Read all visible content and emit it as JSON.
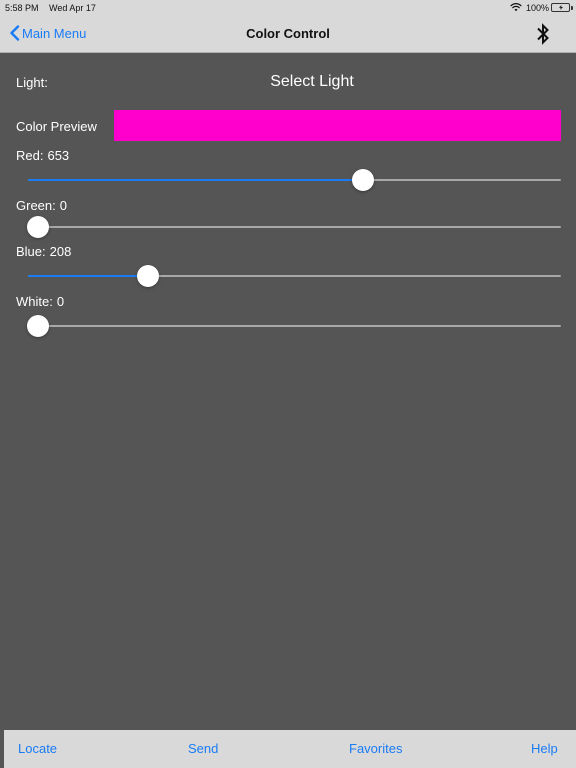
{
  "status_bar": {
    "time": "5:58 PM",
    "date": "Wed Apr 17",
    "battery": "100%",
    "icons": [
      "wifi-icon",
      "battery-icon"
    ]
  },
  "nav": {
    "back_label": "Main Menu",
    "title": "Color Control",
    "icons": [
      "chevron-left-icon",
      "bluetooth-icon"
    ]
  },
  "light": {
    "label": "Light:",
    "select_label": "Select Light"
  },
  "preview": {
    "label": "Color Preview",
    "color": "#ff00cc"
  },
  "sliders": [
    {
      "key": "red",
      "label": "Red:",
      "value": "653",
      "fraction": 0.634
    },
    {
      "key": "green",
      "label": "Green:",
      "value": "0",
      "fraction": 0.0
    },
    {
      "key": "blue",
      "label": "Blue:",
      "value": "208",
      "fraction": 0.214
    },
    {
      "key": "white",
      "label": "White:",
      "value": "0",
      "fraction": 0.0
    }
  ],
  "tabs": {
    "locate": "Locate",
    "send": "Send",
    "favorites": "Favorites",
    "help": "Help"
  },
  "colors": {
    "accent": "#1a7cf5",
    "background": "#555555",
    "bar": "#d9d9d9",
    "battery": "#35c759"
  }
}
